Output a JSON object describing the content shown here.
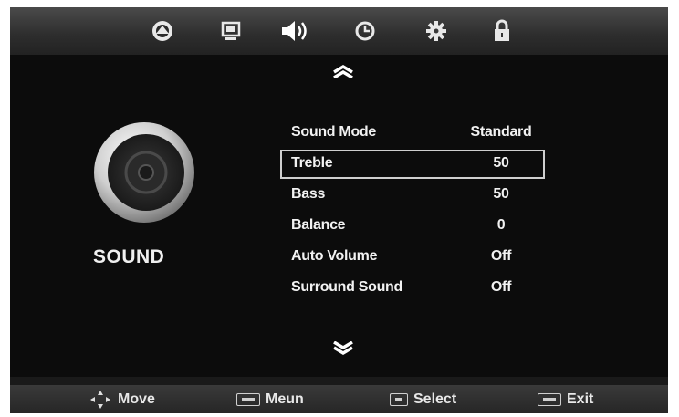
{
  "tabs": [
    {
      "name": "picture",
      "icon": "picture-icon"
    },
    {
      "name": "screen",
      "icon": "screen-icon"
    },
    {
      "name": "sound",
      "icon": "speaker-icon"
    },
    {
      "name": "time",
      "icon": "clock-icon"
    },
    {
      "name": "setup",
      "icon": "gear-icon"
    },
    {
      "name": "lock",
      "icon": "lock-icon"
    }
  ],
  "category": {
    "title": "SOUND",
    "icon": "speaker-cone-icon"
  },
  "menu": {
    "items": [
      {
        "label": "Sound Mode",
        "value": "Standard",
        "selected": false
      },
      {
        "label": "Treble",
        "value": "50",
        "selected": true
      },
      {
        "label": "Bass",
        "value": "50",
        "selected": false
      },
      {
        "label": "Balance",
        "value": "0",
        "selected": false
      },
      {
        "label": "Auto Volume",
        "value": "Off",
        "selected": false
      },
      {
        "label": "Surround Sound",
        "value": "Off",
        "selected": false
      }
    ]
  },
  "hints": {
    "move": "Move",
    "menu": "Meun",
    "select": "Select",
    "exit": "Exit"
  },
  "colors": {
    "background": "#101010",
    "topbar": "#3a3a3a",
    "text": "#f2f2f2",
    "selection_border": "#cfcfcf"
  }
}
